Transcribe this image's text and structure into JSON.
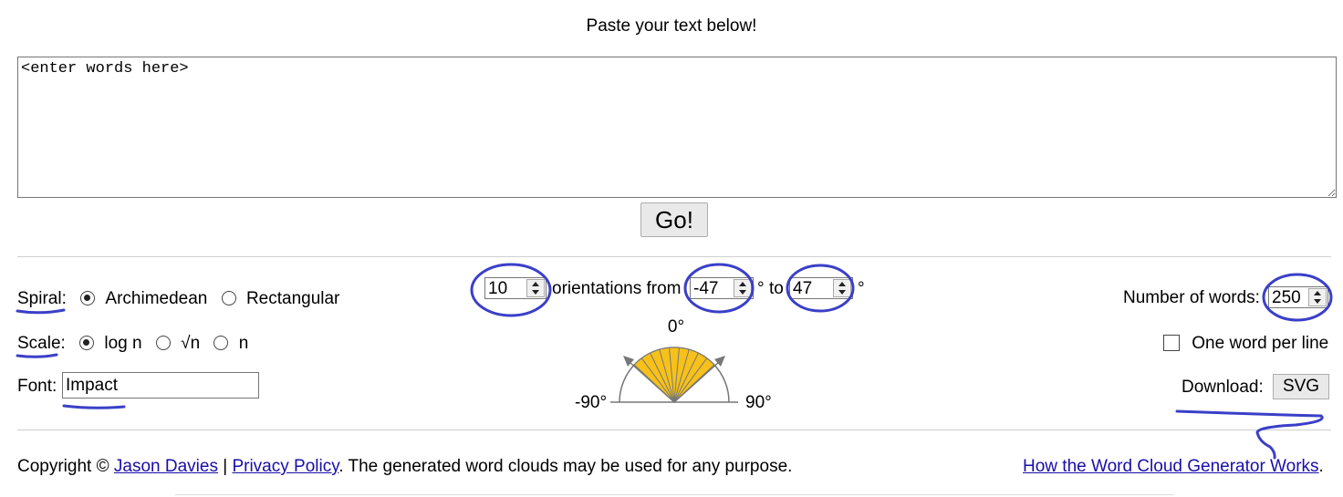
{
  "heading": "Paste your text below!",
  "textarea": {
    "value": "<enter words here>"
  },
  "go_label": "Go!",
  "spiral": {
    "label": "Spiral",
    "options": [
      "Archimedean",
      "Rectangular"
    ],
    "selected": "Archimedean"
  },
  "scale": {
    "label": "Scale",
    "options": [
      "log n",
      "√n",
      "n"
    ],
    "selected": "log n"
  },
  "font": {
    "label": "Font:",
    "value": "Impact"
  },
  "orientations": {
    "count": "10",
    "text_from": "orientations from",
    "from": "-47",
    "degree_sign": "°",
    "text_to": "to",
    "to": "47"
  },
  "angle_labels": {
    "top": "0°",
    "left": "-90°",
    "right": "90°"
  },
  "number_of_words": {
    "label": "Number of words:",
    "value": "250"
  },
  "one_word_per_line": {
    "label": "One word per line",
    "checked": false
  },
  "download": {
    "label": "Download:",
    "button": "SVG"
  },
  "footer": {
    "copyright": "Copyright ©",
    "author_link": "Jason Davies",
    "pipe": "|",
    "privacy_link": "Privacy Policy",
    "notice": ". The generated word clouds may be used for any purpose.",
    "how_link": "How the Word Cloud Generator Works",
    "period": "."
  },
  "colors": {
    "fan_fill": "#f7c119",
    "annotation": "#3a3fc8",
    "link": "#1a0dab"
  }
}
